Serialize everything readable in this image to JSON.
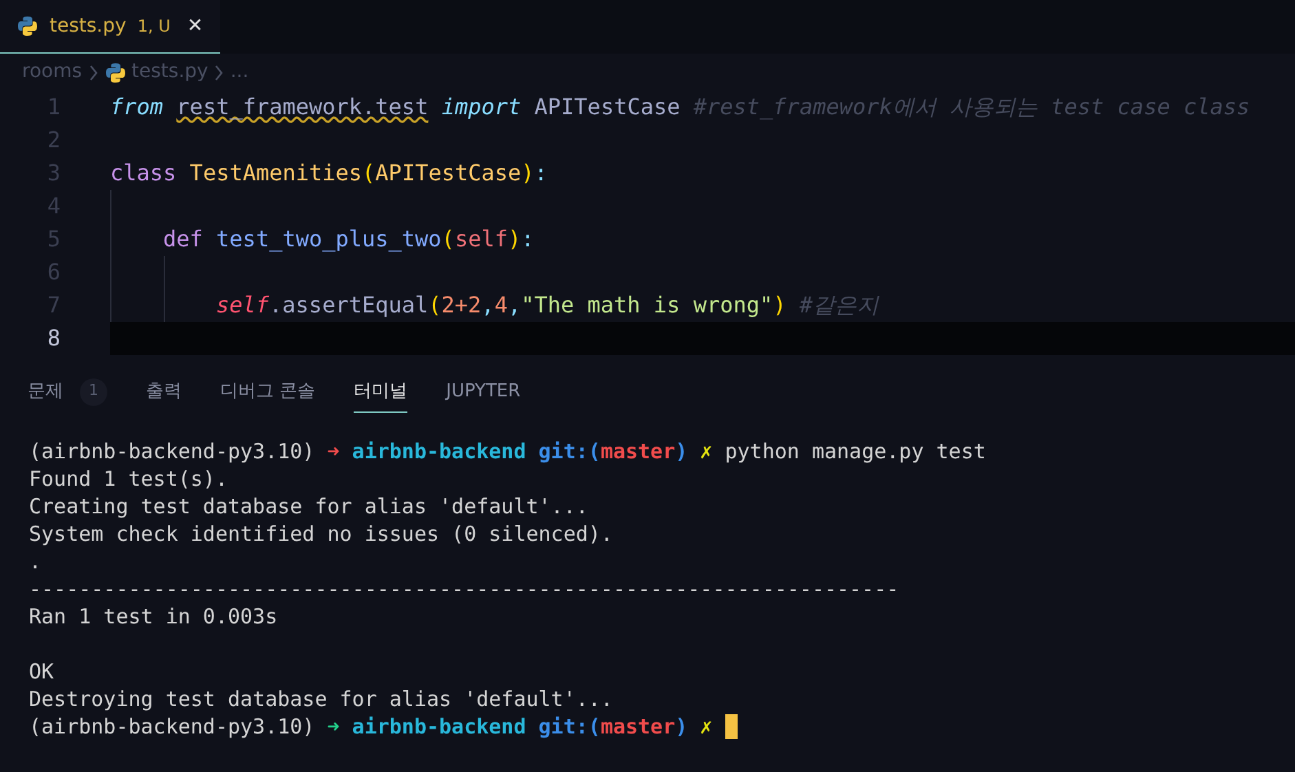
{
  "editor_tab": {
    "filename": "tests.py",
    "status": "1, U",
    "close": "✕",
    "selected": true
  },
  "breadcrumbs": [
    {
      "text": "rooms",
      "kind": "folder"
    },
    {
      "text": "tests.py",
      "kind": "python-file"
    },
    {
      "text": "...",
      "kind": "more"
    }
  ],
  "code_lines": [
    {
      "number": "1",
      "current": false,
      "tokens": [
        {
          "text": "from ",
          "kind": "keyword-italic"
        },
        {
          "text": "rest_framework.test",
          "kind": "warning"
        },
        {
          "text": " import",
          "kind": "keyword-italic"
        },
        {
          "text": " APITestCase ",
          "kind": "plain"
        },
        {
          "text": "#rest_framework에서 사용되는 test case class",
          "kind": "comment"
        }
      ]
    },
    {
      "number": "2",
      "current": false
    },
    {
      "number": "3",
      "current": false,
      "tokens": [
        {
          "text": "class",
          "kind": "keyword"
        },
        {
          "text": " TestAmenities",
          "kind": "class"
        },
        {
          "text": "(",
          "kind": "paren"
        },
        {
          "text": "APITestCase",
          "kind": "class"
        },
        {
          "text": ")",
          "kind": "paren"
        },
        {
          "text": ":",
          "kind": "punct"
        }
      ],
      "children": [
        {
          "number": "4",
          "current": false
        },
        {
          "number": "5",
          "current": false,
          "tokens": [
            {
              "text": "def",
              "kind": "keyword"
            },
            {
              "text": " test_two_plus_two",
              "kind": "function"
            },
            {
              "text": "(",
              "kind": "paren"
            },
            {
              "text": "self",
              "kind": "param"
            },
            {
              "text": ")",
              "kind": "paren"
            },
            {
              "text": ":",
              "kind": "punct"
            }
          ],
          "children": [
            {
              "number": "6",
              "current": false
            },
            {
              "number": "7",
              "current": false,
              "tokens": [
                {
                  "text": "self",
                  "kind": "self"
                },
                {
                  "text": ".assertEqual",
                  "kind": "method"
                },
                {
                  "text": "(",
                  "kind": "paren"
                },
                {
                  "text": "2+2",
                  "kind": "number"
                },
                {
                  "text": ",",
                  "kind": "punct"
                },
                {
                  "text": "4",
                  "kind": "number"
                },
                {
                  "text": ",",
                  "kind": "punct"
                },
                {
                  "text": "\"The math is wrong\"",
                  "kind": "string"
                },
                {
                  "text": ")",
                  "kind": "paren"
                },
                {
                  "text": " #같은지",
                  "kind": "comment"
                }
              ]
            }
          ]
        }
      ]
    },
    {
      "number": "8",
      "current": true
    }
  ],
  "panel_tabs": [
    {
      "label": "문제",
      "badge": "1",
      "selected": false
    },
    {
      "label": "출력",
      "selected": false
    },
    {
      "label": "디버그 콘솔",
      "selected": false
    },
    {
      "label": "터미널",
      "selected": true
    },
    {
      "label": "JUPYTER",
      "selected": false
    }
  ],
  "terminal_lines": [
    {
      "tokens": [
        {
          "text": "(airbnb-backend-py3.10) ",
          "kind": "plain"
        },
        {
          "text": "➜",
          "kind": "arrow-fail"
        },
        {
          "text": " airbnb-backend",
          "kind": "dir"
        },
        {
          "text": " git:(",
          "kind": "git"
        },
        {
          "text": "master",
          "kind": "branch"
        },
        {
          "text": ")",
          "kind": "git"
        },
        {
          "text": " ✗",
          "kind": "dirty"
        },
        {
          "text": " python manage.py test",
          "kind": "plain"
        }
      ]
    },
    {
      "tokens": [
        {
          "text": "Found 1 test(s).",
          "kind": "plain"
        }
      ]
    },
    {
      "tokens": [
        {
          "text": "Creating test database for alias 'default'...",
          "kind": "plain"
        }
      ]
    },
    {
      "tokens": [
        {
          "text": "System check identified no issues (0 silenced).",
          "kind": "plain"
        }
      ]
    },
    {
      "tokens": [
        {
          "text": ".",
          "kind": "plain"
        }
      ]
    },
    {
      "tokens": [
        {
          "text": "----------------------------------------------------------------------",
          "kind": "plain"
        }
      ]
    },
    {
      "tokens": [
        {
          "text": "Ran 1 test in 0.003s",
          "kind": "plain"
        }
      ]
    },
    {
      "blank": true
    },
    {
      "tokens": [
        {
          "text": "OK",
          "kind": "plain"
        }
      ]
    },
    {
      "tokens": [
        {
          "text": "Destroying test database for alias 'default'...",
          "kind": "plain"
        }
      ]
    },
    {
      "cursor": true,
      "tokens": [
        {
          "text": "(airbnb-backend-py3.10) ",
          "kind": "plain"
        },
        {
          "text": "➜",
          "kind": "arrow-ok"
        },
        {
          "text": " airbnb-backend",
          "kind": "dir"
        },
        {
          "text": " git:(",
          "kind": "git"
        },
        {
          "text": "master",
          "kind": "branch"
        },
        {
          "text": ")",
          "kind": "git"
        },
        {
          "text": " ✗",
          "kind": "dirty"
        }
      ]
    }
  ]
}
